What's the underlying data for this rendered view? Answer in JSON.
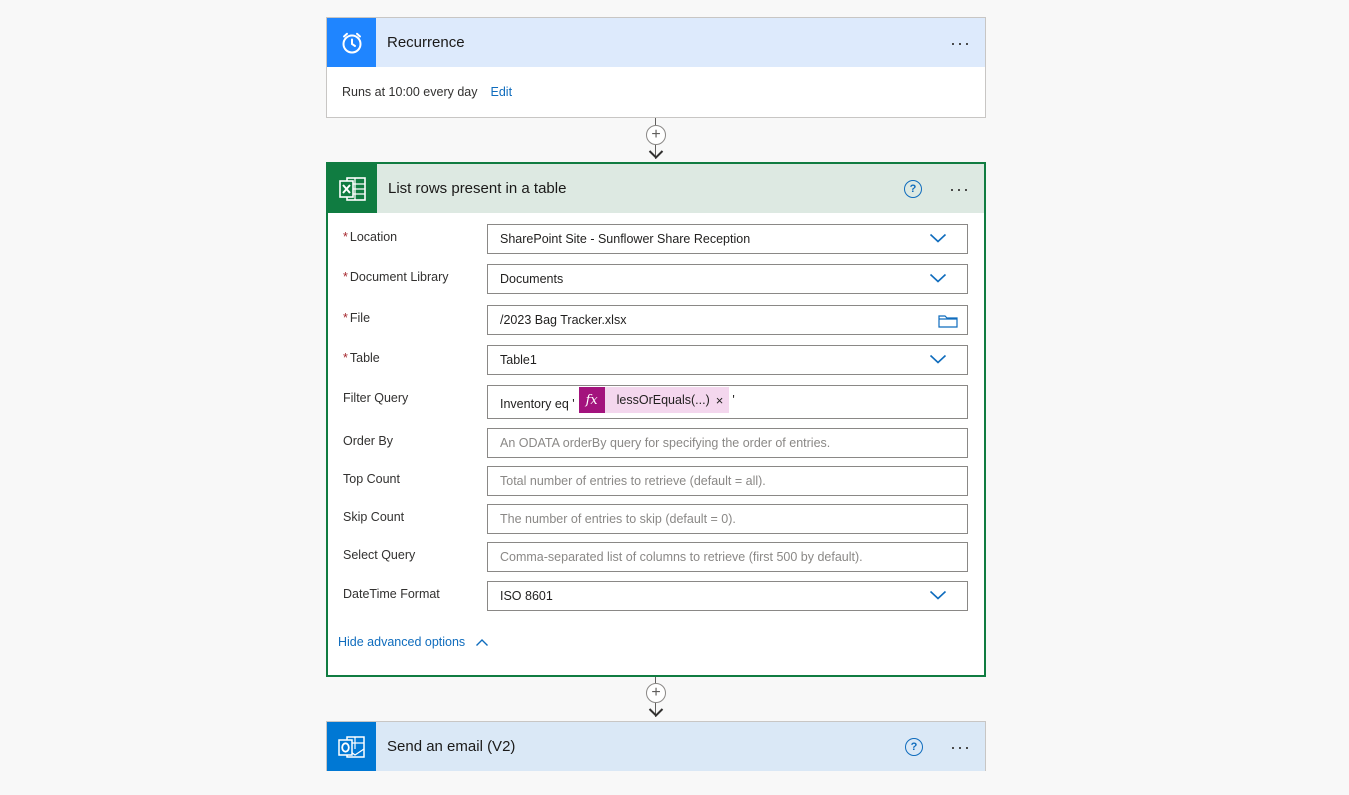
{
  "recurrence": {
    "title": "Recurrence",
    "body_text": "Runs at 10:00 every day",
    "edit_label": "Edit",
    "more_label": "···"
  },
  "list_rows": {
    "title": "List rows present in a table",
    "help_label": "?",
    "more_label": "···",
    "required_mark": "*",
    "fields": {
      "location": {
        "label": "Location",
        "value": "SharePoint Site - Sunflower Share Reception"
      },
      "document_library": {
        "label": "Document Library",
        "value": "Documents"
      },
      "file": {
        "label": "File",
        "value": "/2023 Bag Tracker.xlsx"
      },
      "table": {
        "label": "Table",
        "value": "Table1"
      },
      "filter_query": {
        "label": "Filter Query",
        "prefix": "Inventory eq '",
        "token_icon": "fx",
        "token_label": "lessOrEquals(...)",
        "token_remove": "×",
        "suffix": "'"
      },
      "order_by": {
        "label": "Order By",
        "placeholder": "An ODATA orderBy query for specifying the order of entries."
      },
      "top_count": {
        "label": "Top Count",
        "placeholder": "Total number of entries to retrieve (default = all)."
      },
      "skip_count": {
        "label": "Skip Count",
        "placeholder": "The number of entries to skip (default = 0)."
      },
      "select_query": {
        "label": "Select Query",
        "placeholder": "Comma-separated list of columns to retrieve (first 500 by default)."
      },
      "datetime_format": {
        "label": "DateTime Format",
        "value": "ISO 8601"
      }
    },
    "hide_advanced": "Hide advanced options"
  },
  "send_email": {
    "title": "Send an email (V2)",
    "help_label": "?",
    "more_label": "···"
  },
  "connector_label": "+",
  "icons": [
    "alarm-clock-icon",
    "excel-icon",
    "outlook-icon",
    "chevron-down-icon",
    "folder-icon",
    "chevron-up-icon",
    "help-icon",
    "more-icon",
    "plus-icon",
    "arrow-down-icon"
  ],
  "colors": {
    "recurrence_header": "#ddeafc",
    "recurrence_icon_bg": "#1f85ff",
    "excel_header": "#dde9e2",
    "excel_icon_bg": "#107c41",
    "excel_border": "#107c41",
    "outlook_header": "#dae8f6",
    "outlook_icon_bg": "#0078d4",
    "token_bg": "#f4d7ee",
    "token_icon_bg": "#a3137d",
    "link": "#0f6cbd"
  }
}
